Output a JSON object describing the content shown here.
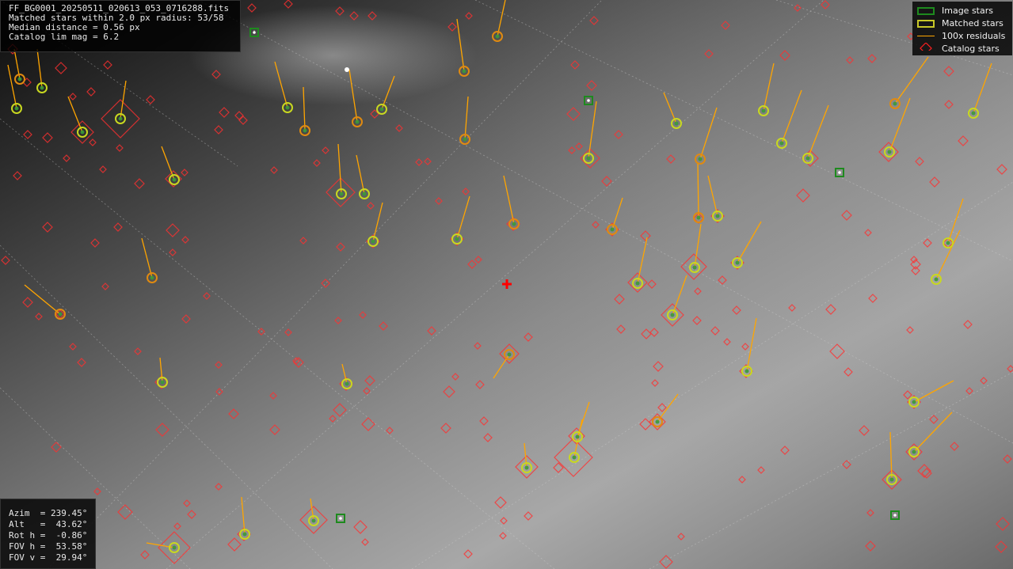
{
  "app": {
    "file_name": "FF_BG0001_20250511_020613_053_0716288.fits",
    "info_lines": [
      "Matched stars within 2.0 px radius: 53/58",
      "Median distance = 0.56 px",
      "Catalog lim mag = 6.2"
    ]
  },
  "legend": {
    "items": [
      {
        "label": "Image stars",
        "color": "#1e8a1e"
      },
      {
        "label": "Matched stars",
        "color": "#c8c828"
      },
      {
        "label": "100x residuals",
        "color": "#ffa500"
      },
      {
        "label": "Catalog stars",
        "color": "#ff2020"
      }
    ]
  },
  "pointing": {
    "lines": [
      "Azim  = 239.45°",
      "Alt   =  43.62°",
      "Rot h =  -0.86°",
      "FOV h =  53.58°",
      "FOV v =  29.94°"
    ]
  },
  "colors": {
    "catalog": "#ff3030",
    "matched": "#c8d820",
    "matched_inner": "#3a9a3a",
    "residual": "#ffa500",
    "image_star": "#1e8a1e",
    "center": "#ff0000",
    "grid": "#d0d0d0"
  }
}
